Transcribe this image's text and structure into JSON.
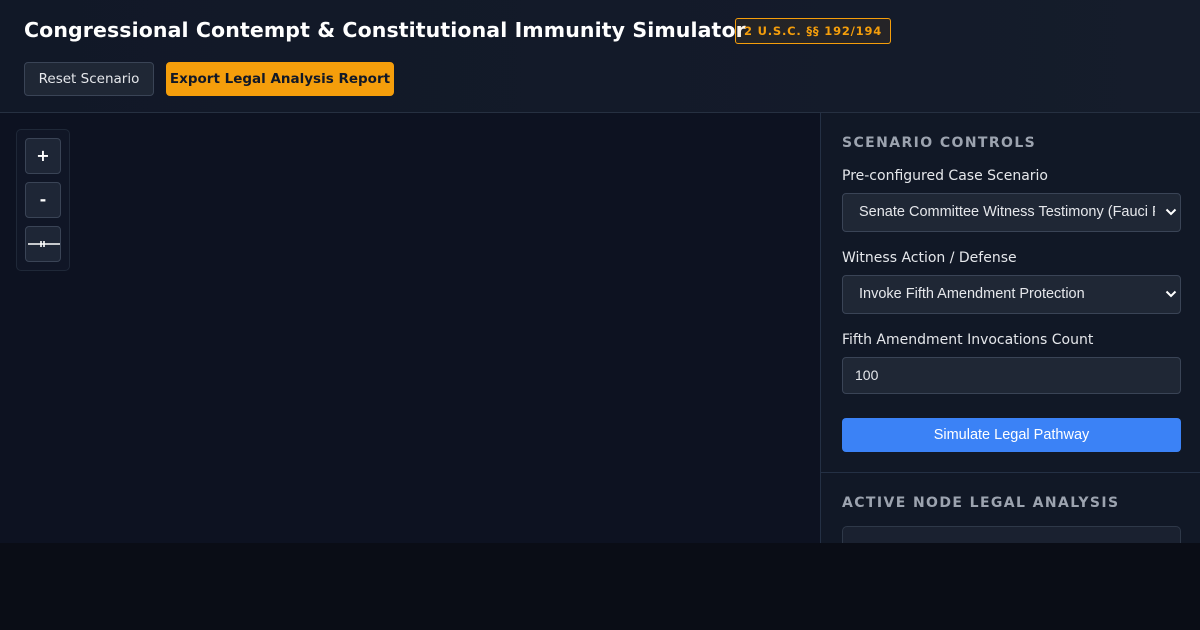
{
  "header": {
    "title": "Congressional Contempt & Constitutional Immunity Simulator",
    "badge": "2 U.S.C. §§ 192/194",
    "reset_label": "Reset Scenario",
    "export_label": "Export Legal Analysis Report"
  },
  "canvas": {
    "zoom_in_label": "+",
    "zoom_out_label": "-",
    "fit_icon": "fit-to-view-icon"
  },
  "sidebar": {
    "controls_title": "SCENARIO CONTROLS",
    "scenario_label": "Pre-configured Case Scenario",
    "scenario_value": "Senate Committee Witness Testimony (Fauci P",
    "action_label": "Witness Action / Defense",
    "action_value": "Invoke Fifth Amendment Protection",
    "count_label": "Fifth Amendment Invocations Count",
    "count_value": "100",
    "simulate_label": "Simulate Legal Pathway",
    "analysis_title": "ACTIVE NODE LEGAL ANALYSIS"
  },
  "colors": {
    "accent": "#f59e0b",
    "primary": "#3b82f6",
    "background": "#0f1422"
  }
}
